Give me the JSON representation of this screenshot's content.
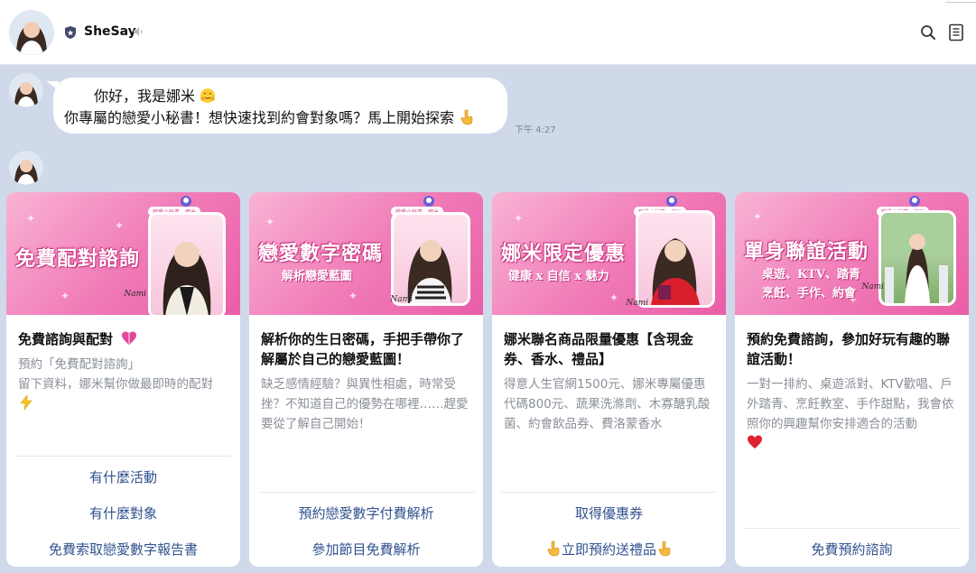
{
  "chat": {
    "name": "SheSay",
    "greeting_line1": "你好，我是娜米",
    "greeting_line2": "你專屬的戀愛小秘書！想快速找到約會對象嗎？馬上開始探索",
    "time": "下午 4:27"
  },
  "icons": [
    "shield-icon",
    "mute-icon",
    "search-icon",
    "notes-icon",
    "hug-emoji-icon",
    "point-down-emoji-icon",
    "heart-gift-emoji-icon",
    "lightning-emoji-icon",
    "red-heart-emoji-icon"
  ],
  "colors": {
    "banner_pink": "#f07ab7",
    "action_blue": "#31528f",
    "bg": "#cfd9ea"
  },
  "cards": [
    {
      "banner_title": "免費配對諮詢",
      "banner_sub": "",
      "banner_tag": "戀愛小秘書．娜米",
      "banner_sig": "Nami",
      "title": "免費諮詢與配對",
      "text_1": "預約「免費配對諮詢」",
      "text_2": "留下資料，娜米幫你做最即時的配對",
      "actions": [
        "有什麼活動",
        "有什麼對象",
        "免費索取戀愛數字報告書"
      ]
    },
    {
      "banner_title": "戀愛數字密碼",
      "banner_sub": "解析戀愛藍圖",
      "banner_tag": "戀愛小秘書．娜米",
      "banner_sig": "Nami",
      "title": "解析你的生日密碼，手把手帶你了解屬於自己的戀愛藍圖！",
      "text": "缺乏感情經驗？與異性相處，時常受挫？不知道自己的優勢在哪裡……趕愛要從了解自己開始！",
      "actions": [
        "預約戀愛數字付費解析",
        "參加節目免費解析"
      ]
    },
    {
      "banner_title": "娜米限定優惠",
      "banner_sub": "健康 x 自信 x 魅力",
      "banner_tag": "戀愛小秘書．娜米",
      "banner_sig": "Nami",
      "title": "娜米聯名商品限量優惠【含現金券、香水、禮品】",
      "text": "得意人生官網1500元、娜米專屬優惠代碼800元、蔬果洗滌劑、木寡醣乳酸菌、約會飲品券、費洛蒙香水",
      "actions": [
        "取得優惠券",
        "立即預約送禮品"
      ]
    },
    {
      "banner_title": "單身聯誼活動",
      "banner_sub_1": "桌遊、KTV、踏青",
      "banner_sub_2": "烹飪、手作、約會",
      "banner_tag": "戀愛小秘書．娜米",
      "banner_sig": "Nami",
      "title": "預約免費諮詢，參加好玩有趣的聯誼活動！",
      "text": "一對一排約、桌遊派對、KTV歡唱、戶外踏青、烹飪教室、手作甜點，我會依照你的興趣幫你安排適合的活動",
      "actions": [
        "免費預約諮詢"
      ]
    }
  ]
}
